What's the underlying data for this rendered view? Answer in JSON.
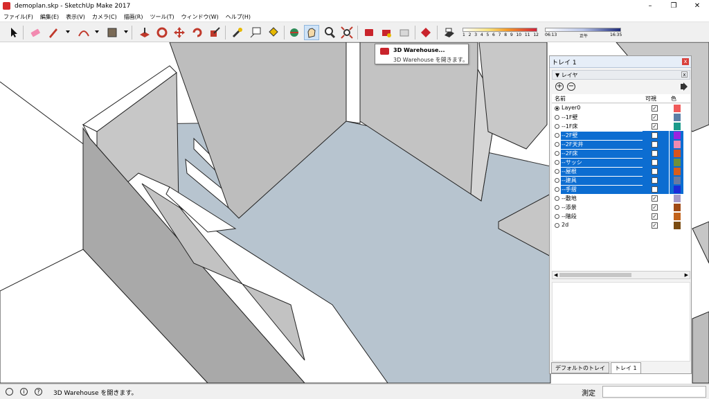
{
  "window": {
    "title": "demoplan.skp - SketchUp Make 2017",
    "minimize": "–",
    "maximize": "❐",
    "close": "✕"
  },
  "menu": [
    "ファイル(F)",
    "編集(E)",
    "表示(V)",
    "カメラ(C)",
    "描画(R)",
    "ツール(T)",
    "ウィンドウ(W)",
    "ヘルプ(H)"
  ],
  "shadow": {
    "months": [
      "1",
      "2",
      "3",
      "4",
      "5",
      "6",
      "7",
      "8",
      "9",
      "10",
      "11",
      "12"
    ]
  },
  "time": {
    "start": "06:13",
    "noon": "正午",
    "end": "16:35"
  },
  "tooltip": {
    "title": "3D Warehouse...",
    "description": "3D Warehouse を開きます。"
  },
  "tray": {
    "title": "トレイ 1",
    "close": "x",
    "panel_title": "▼ レイヤ",
    "panel_close": "x",
    "add": "+",
    "remove": "−",
    "col_name": "名前",
    "col_visible": "可視",
    "col_color": "色",
    "layers": [
      {
        "name": "Layer0",
        "active": true,
        "visible": true,
        "selected": false,
        "color": "#f05a5a"
      },
      {
        "name": "--1F壁",
        "active": false,
        "visible": true,
        "selected": false,
        "color": "#5b7fa6"
      },
      {
        "name": "--1F床",
        "active": false,
        "visible": true,
        "selected": false,
        "color": "#1a9a8a"
      },
      {
        "name": "--2F壁",
        "active": false,
        "visible": false,
        "selected": true,
        "color": "#9a22e0"
      },
      {
        "name": "--2F天井",
        "active": false,
        "visible": false,
        "selected": true,
        "color": "#f08ab0"
      },
      {
        "name": "--2F床",
        "active": false,
        "visible": false,
        "selected": true,
        "color": "#d9541c"
      },
      {
        "name": "--サッシ",
        "active": false,
        "visible": false,
        "selected": true,
        "color": "#6f8f3a"
      },
      {
        "name": "--屋根",
        "active": false,
        "visible": false,
        "selected": true,
        "color": "#d95e1a"
      },
      {
        "name": "--建具",
        "active": false,
        "visible": false,
        "selected": true,
        "color": "#6a7aa0"
      },
      {
        "name": "--手摺",
        "active": false,
        "visible": false,
        "selected": true,
        "color": "#1b2ad9"
      },
      {
        "name": "--敷地",
        "active": false,
        "visible": true,
        "selected": false,
        "color": "#a69ac8"
      },
      {
        "name": "--添景",
        "active": false,
        "visible": true,
        "selected": false,
        "color": "#a04a14"
      },
      {
        "name": "--階段",
        "active": false,
        "visible": true,
        "selected": false,
        "color": "#c2621a"
      },
      {
        "name": "2d",
        "active": false,
        "visible": true,
        "selected": false,
        "color": "#7a4a10"
      }
    ],
    "scroll_left": "◀",
    "scroll_right": "▶",
    "tabs": [
      "デフォルトのトレイ",
      "トレイ 1"
    ]
  },
  "status": {
    "message": "3D Warehouse を開きます。",
    "measure_label": "測定",
    "measure_value": "",
    "icons": [
      "i",
      "?"
    ]
  },
  "colors": {
    "selection": "#0c6dd1",
    "floor": "#b7c4cf",
    "wall": "#bfbfbf"
  }
}
